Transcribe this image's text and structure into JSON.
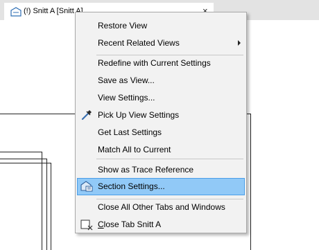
{
  "tab": {
    "title": "(!) Snitt A [Snitt A]",
    "close_symbol": "×",
    "icon": "section-view-icon"
  },
  "menu": {
    "items": [
      {
        "label": "Restore View"
      },
      {
        "label": "Recent Related Views",
        "submenu": true
      },
      {
        "label": "Redefine with Current Settings"
      },
      {
        "label": "Save as View..."
      },
      {
        "label": "View Settings..."
      },
      {
        "label": "Pick Up View Settings",
        "icon": "eyedropper-icon"
      },
      {
        "label": "Get Last Settings"
      },
      {
        "label": "Match All to Current"
      },
      {
        "label": "Show as Trace Reference"
      },
      {
        "label": "Section Settings...",
        "icon": "section-settings-icon",
        "highlighted": true
      },
      {
        "label": "Close All Other Tabs and Windows"
      },
      {
        "label_underlined": "C",
        "label_rest": "lose Tab Snitt A",
        "icon": "close-tab-icon"
      }
    ]
  },
  "colors": {
    "highlight_fill": "#91c9f7",
    "highlight_border": "#4a9ee8",
    "menu_background": "#f2f2f2",
    "tabstrip_background": "#e3e3e3"
  }
}
